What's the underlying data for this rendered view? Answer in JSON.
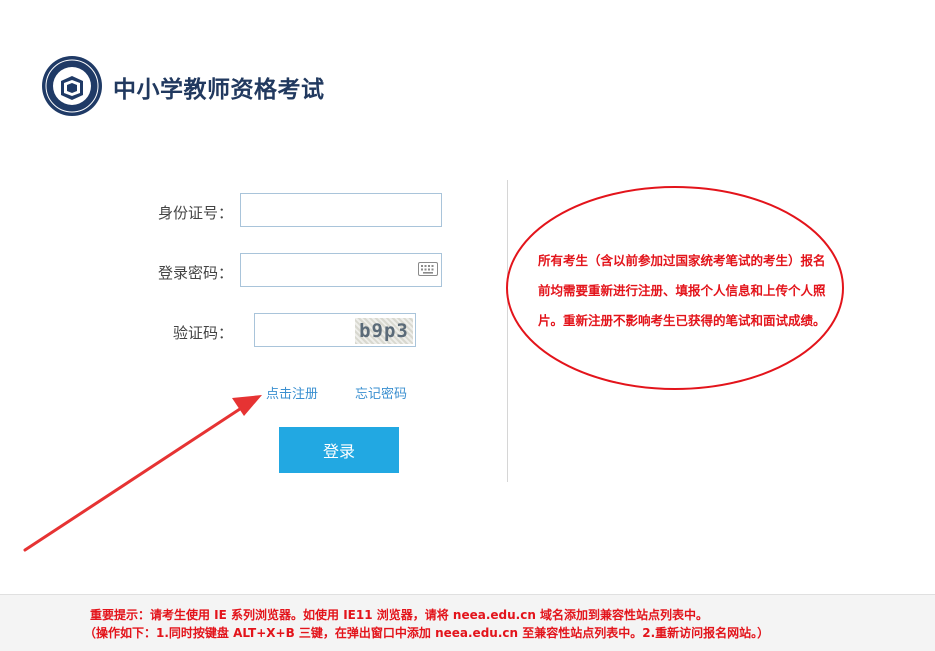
{
  "header": {
    "title": "中小学教师资格考试",
    "logo_icon": "teacher-certification-seal-icon"
  },
  "form": {
    "id_label": "身份证号：",
    "id_value": "",
    "password_label": "登录密码：",
    "password_value": "",
    "keyboard_icon": "keyboard-icon",
    "captcha_label": "验证码：",
    "captcha_value": "",
    "captcha_text": "b9p3",
    "register_link": "点击注册",
    "forgot_link": "忘记密码",
    "login_button": "登录"
  },
  "notice": {
    "text": "所有考生（含以前参加过国家统考笔试的考生）报名前均需要重新进行注册、填报个人信息和上传个人照片。重新注册不影响考生已获得的笔试和面试成绩。"
  },
  "footer": {
    "line1": "重要提示：请考生使用 IE 系列浏览器。如使用 IE11 浏览器，请将 neea.edu.cn 域名添加到兼容性站点列表中。",
    "line2": "（操作如下：1.同时按键盘 ALT+X+B 三键，在弹出窗口中添加 neea.edu.cn 至兼容性站点列表中。2.重新访问报名网站。）"
  },
  "colors": {
    "accent": "#22a8e2",
    "link": "#3a8fd0",
    "notice_red": "#e3141b",
    "title_navy": "#21395f"
  }
}
